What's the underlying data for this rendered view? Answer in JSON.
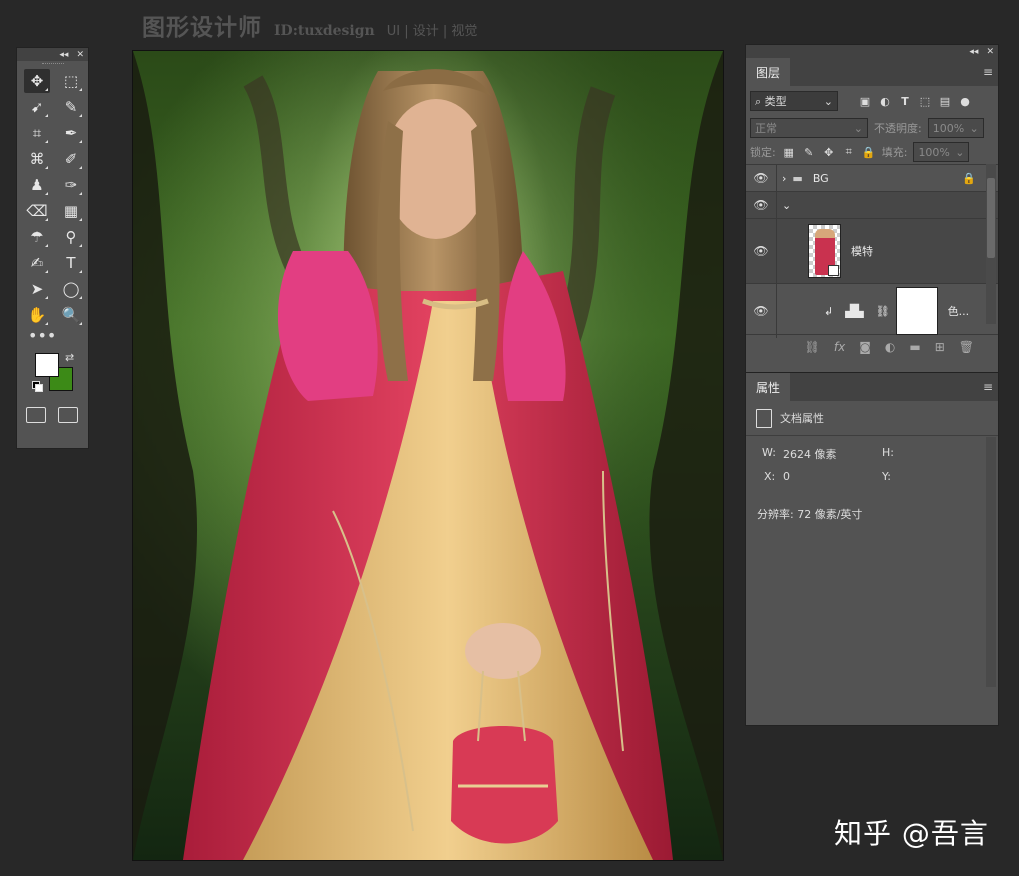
{
  "watermark_top": {
    "title": "图形设计师",
    "id": "ID:tuxdesign",
    "tags": "UI | 设计 | 视觉"
  },
  "watermark_bottom": "知乎 @吾言",
  "toolbox": {
    "header_icons": [
      "collapse-icon",
      "close-icon"
    ],
    "tools": [
      {
        "name": "move-tool",
        "glyph": "✥",
        "active": true
      },
      {
        "name": "marquee-tool",
        "glyph": "⬚"
      },
      {
        "name": "lasso-tool",
        "glyph": "➹"
      },
      {
        "name": "quick-select-tool",
        "glyph": "✎"
      },
      {
        "name": "crop-tool",
        "glyph": "⌗"
      },
      {
        "name": "eyedropper-tool",
        "glyph": "✒"
      },
      {
        "name": "healing-tool",
        "glyph": "⌘"
      },
      {
        "name": "brush-tool",
        "glyph": "✐"
      },
      {
        "name": "stamp-tool",
        "glyph": "♟"
      },
      {
        "name": "history-brush-tool",
        "glyph": "✑"
      },
      {
        "name": "eraser-tool",
        "glyph": "⌫"
      },
      {
        "name": "gradient-tool",
        "glyph": "▦"
      },
      {
        "name": "blur-tool",
        "glyph": "☂"
      },
      {
        "name": "dodge-tool",
        "glyph": "⚲"
      },
      {
        "name": "pen-tool",
        "glyph": "✍"
      },
      {
        "name": "type-tool",
        "glyph": "T"
      },
      {
        "name": "path-select-tool",
        "glyph": "➤"
      },
      {
        "name": "ellipse-tool",
        "glyph": "◯"
      },
      {
        "name": "hand-tool",
        "glyph": "✋"
      },
      {
        "name": "zoom-tool",
        "glyph": "🔍"
      }
    ],
    "more": "•••",
    "foreground_color": "#ffffff",
    "background_color": "#3c8a17"
  },
  "layers_panel": {
    "tab": "图层",
    "filter_label": "类型",
    "blend_mode": "正常",
    "opacity_label": "不透明度:",
    "opacity_value": "100%",
    "lock_label": "锁定:",
    "fill_label": "填充:",
    "fill_value": "100%",
    "layers": [
      {
        "name": "BG",
        "type": "group",
        "collapsed": true,
        "locked": true
      },
      {
        "name": "",
        "type": "group",
        "expanded": true
      },
      {
        "name": "模特",
        "type": "smart-object"
      },
      {
        "name": "色...",
        "type": "adjustment"
      }
    ]
  },
  "properties_panel": {
    "tab": "属性",
    "section_title": "文档属性",
    "w_label": "W:",
    "w_value": "2624 像素",
    "h_label": "H:",
    "x_label": "X:",
    "x_value": "0",
    "y_label": "Y:",
    "resolution": "分辨率: 72 像素/英寸"
  },
  "colors": {
    "app_bg": "#282828",
    "panel_bg": "#535353",
    "panel_header": "#424242"
  }
}
